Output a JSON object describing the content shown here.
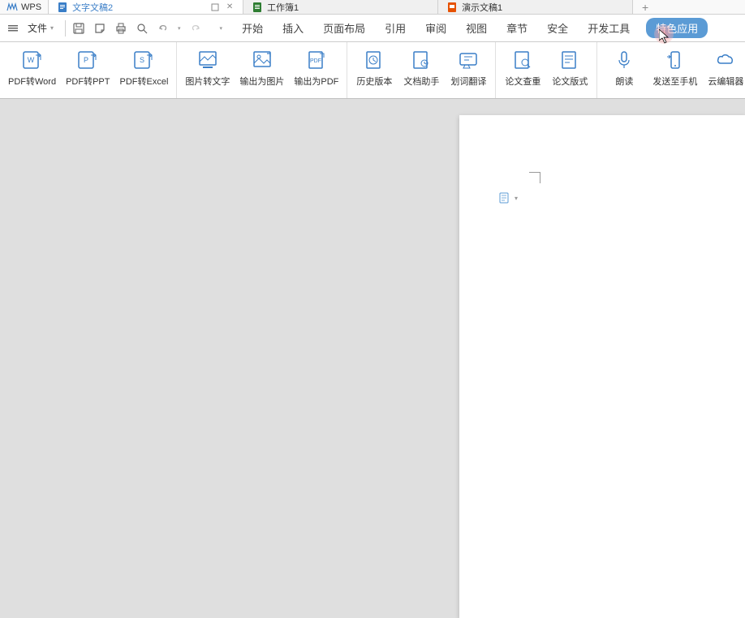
{
  "titleBar": {
    "appName": "WPS",
    "tabs": [
      {
        "icon": "doc",
        "label": "文字文稿2",
        "color": "#3a7ec7",
        "active": true,
        "hasControls": true
      },
      {
        "icon": "sheet",
        "label": "工作簿1",
        "color": "#2e7d32",
        "active": false,
        "hasControls": false
      },
      {
        "icon": "pres",
        "label": "演示文稿1",
        "color": "#e65100",
        "active": false,
        "hasControls": false
      }
    ],
    "newTabLabel": "+"
  },
  "menuBar": {
    "fileMenu": "文件",
    "menuTabs": [
      {
        "label": "开始"
      },
      {
        "label": "插入"
      },
      {
        "label": "页面布局"
      },
      {
        "label": "引用"
      },
      {
        "label": "审阅"
      },
      {
        "label": "视图"
      },
      {
        "label": "章节"
      },
      {
        "label": "安全"
      },
      {
        "label": "开发工具"
      },
      {
        "label": "特色应用",
        "highlight": true
      }
    ]
  },
  "ribbon": {
    "groups": [
      {
        "items": [
          {
            "icon": "pdf-word",
            "label": "PDF转Word"
          },
          {
            "icon": "pdf-ppt",
            "label": "PDF转PPT"
          },
          {
            "icon": "pdf-excel",
            "label": "PDF转Excel"
          }
        ]
      },
      {
        "items": [
          {
            "icon": "img-text",
            "label": "图片转文字"
          },
          {
            "icon": "export-img",
            "label": "输出为图片"
          },
          {
            "icon": "export-pdf",
            "label": "输出为PDF"
          }
        ]
      },
      {
        "items": [
          {
            "icon": "history",
            "label": "历史版本"
          },
          {
            "icon": "doc-helper",
            "label": "文档助手"
          },
          {
            "icon": "translate",
            "label": "划词翻译"
          }
        ]
      },
      {
        "items": [
          {
            "icon": "paper-check",
            "label": "论文查重"
          },
          {
            "icon": "paper-format",
            "label": "论文版式"
          }
        ]
      },
      {
        "items": [
          {
            "icon": "read",
            "label": "朗读"
          },
          {
            "icon": "send-phone",
            "label": "发送至手机"
          },
          {
            "icon": "cloud-edit",
            "label": "云编辑器"
          }
        ]
      }
    ]
  }
}
